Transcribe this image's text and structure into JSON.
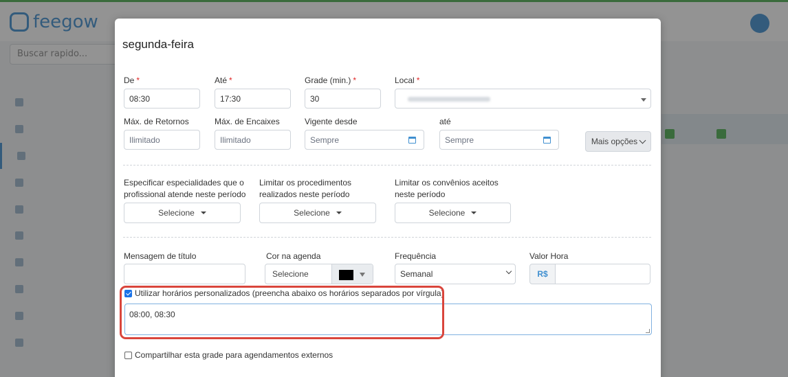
{
  "background": {
    "logo_text": "feegow",
    "search_placeholder": "Buscar rapido..."
  },
  "modal": {
    "title": "segunda-feira",
    "row1": {
      "de_label": "De",
      "de_value": "08:30",
      "ate_label": "Até",
      "ate_value": "17:30",
      "grade_label": "Grade (min.)",
      "grade_value": "30",
      "local_label": "Local",
      "required_mark": "*"
    },
    "row2": {
      "max_retornos_label": "Máx. de Retornos",
      "max_retornos_placeholder": "Ilimitado",
      "max_encaixes_label": "Máx. de Encaixes",
      "max_encaixes_placeholder": "Ilimitado",
      "vigente_label": "Vigente desde",
      "vigente_placeholder": "Sempre",
      "ate_label": "até",
      "ate_placeholder": "Sempre",
      "mais_opcoes": "Mais opções"
    },
    "row3": {
      "especialidades_label_1": "Especificar especialidades que o",
      "especialidades_label_2": "profissional atende neste período",
      "procedimentos_label_1": "Limitar os procedimentos",
      "procedimentos_label_2": "realizados neste período",
      "convenios_label_1": "Limitar os convênios aceitos",
      "convenios_label_2": "neste período",
      "selecione": "Selecione"
    },
    "row4": {
      "mensagem_label": "Mensagem de título",
      "cor_label": "Cor na agenda",
      "cor_value": "Selecione",
      "cor_swatch": "#000000",
      "frequencia_label": "Frequência",
      "frequencia_value": "Semanal",
      "valor_hora_label": "Valor Hora",
      "currency": "R$"
    },
    "custom_hours": {
      "checkbox_label": "Utilizar horários personalizados (preencha abaixo os horários separados por vírgula)",
      "checked": true,
      "value": "08:00, 08:30"
    },
    "share": {
      "checkbox_label": "Compartilhar esta grade para agendamentos externos",
      "checked": false
    }
  },
  "colors": {
    "accent": "#3f8fd0",
    "highlight": "#d9453c",
    "required": "#e02424"
  }
}
